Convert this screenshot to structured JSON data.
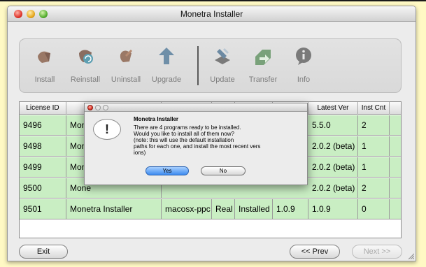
{
  "window": {
    "title": "Monetra Installer"
  },
  "toolbar": {
    "items": [
      {
        "label": "Install",
        "icon": "install-icon"
      },
      {
        "label": "Reinstall",
        "icon": "reinstall-icon"
      },
      {
        "label": "Uninstall",
        "icon": "uninstall-icon"
      },
      {
        "label": "Upgrade",
        "icon": "upgrade-icon"
      },
      {
        "label": "Update",
        "icon": "update-icon"
      },
      {
        "label": "Transfer",
        "icon": "transfer-icon"
      },
      {
        "label": "Info",
        "icon": "info-icon"
      }
    ]
  },
  "table": {
    "headers": [
      "License ID",
      "",
      "",
      "",
      "",
      "",
      "Latest Ver",
      "Inst Cnt"
    ],
    "rows": [
      [
        "9496",
        "Mone",
        "",
        "",
        "",
        "",
        "5.5.0",
        "2"
      ],
      [
        "9498",
        "Mone",
        "",
        "",
        "",
        "",
        "2.0.2 (beta)",
        "1"
      ],
      [
        "9499",
        "Mone",
        "",
        "",
        "",
        "",
        "2.0.2 (beta)",
        "1"
      ],
      [
        "9500",
        "Mone",
        "",
        "",
        "",
        "",
        "2.0.2 (beta)",
        "2"
      ],
      [
        "9501",
        "Monetra Installer",
        "macosx-ppc",
        "Real",
        "Installed",
        "1.0.9",
        "1.0.9",
        "0"
      ]
    ]
  },
  "footer": {
    "exit_label": "Exit",
    "prev_label": "<< Prev",
    "next_label": "Next >>"
  },
  "dialog": {
    "title": "Monetra Installer",
    "icon": "!",
    "message": "There are 4 programs ready to be installed.\nWould you like to install all of them now?\n(note: this will use the default installation\npaths for each one, and install the most recent vers\nions)",
    "yes_label": "Yes",
    "no_label": "No"
  },
  "colors": {
    "row_green": "#c9eec3",
    "page_background": "#fff9c4"
  }
}
